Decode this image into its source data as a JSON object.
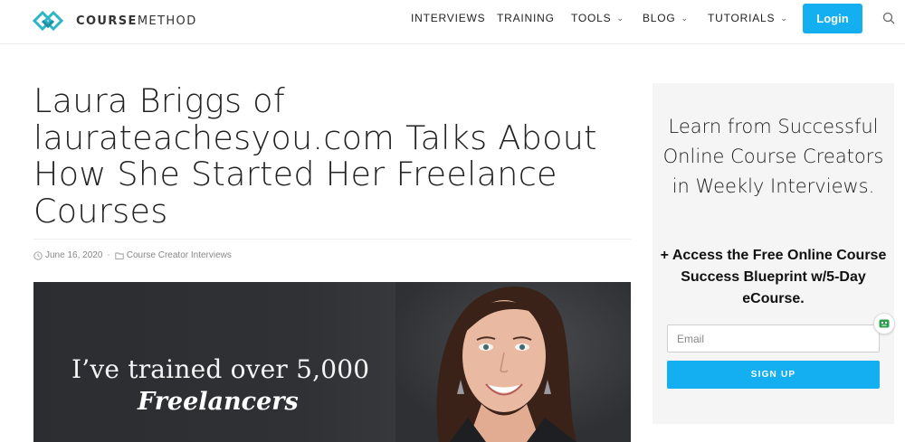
{
  "header": {
    "logo": {
      "bold": "COURSE",
      "light": "METHOD",
      "icon": "diamond-logo-icon"
    },
    "nav": [
      {
        "label": "INTERVIEWS",
        "has_dropdown": false
      },
      {
        "label": "TRAINING",
        "has_dropdown": false
      },
      {
        "label": "TOOLS",
        "has_dropdown": true
      },
      {
        "label": "BLOG",
        "has_dropdown": true
      },
      {
        "label": "TUTORIALS",
        "has_dropdown": true
      }
    ],
    "login_label": "Login",
    "search_icon": "search-icon"
  },
  "article": {
    "title": "Laura Briggs of laurateachesyou.com Talks About How She Started Her Freelance Courses",
    "date": "June 16, 2020",
    "category": "Course Creator Interviews",
    "hero": {
      "line1": "I’ve trained over 5,000",
      "line2": "Freelancers"
    }
  },
  "sidebar": {
    "heading": "Learn from Successful Online Course Creators in Weekly Interviews.",
    "subheading": "+ Access the Free Online Course Success Blueprint w/5-Day eCourse.",
    "email_placeholder": "Email",
    "signup_label": "SIGN UP"
  },
  "colors": {
    "accent": "#13aff0",
    "logo_teal": "#2bb5c7",
    "sidebar_bg": "#f5f5f5",
    "hero_bg": "#2f3134"
  }
}
